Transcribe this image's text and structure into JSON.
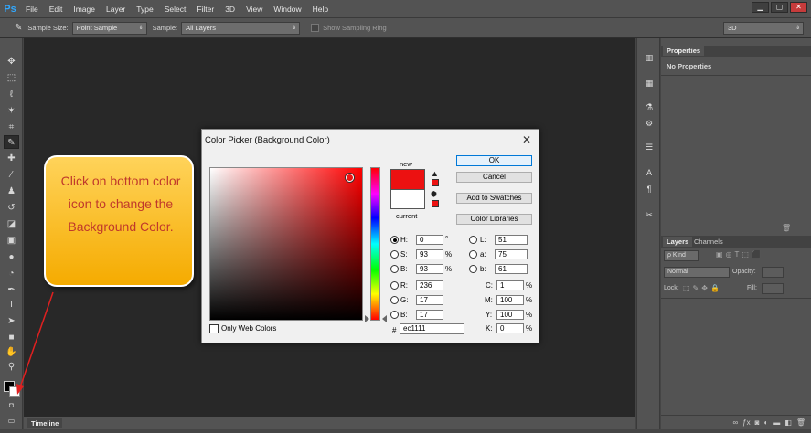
{
  "app": {
    "logo": "Ps"
  },
  "menu": [
    "File",
    "Edit",
    "Image",
    "Layer",
    "Type",
    "Select",
    "Filter",
    "3D",
    "View",
    "Window",
    "Help"
  ],
  "window_controls": [
    "▁",
    "▢",
    "✕"
  ],
  "options": {
    "sample_size_label": "Sample Size:",
    "sample_size_value": "Point Sample",
    "sample_label": "Sample:",
    "sample_value": "All Layers",
    "show_ring_label": "Show Sampling Ring",
    "workspace_value": "3D"
  },
  "panels": {
    "properties_tab": "Properties",
    "no_properties": "No Properties",
    "layers_tab": "Layers",
    "channels_tab": "Channels",
    "kind_label": "ρ Kind",
    "blend_mode": "Normal",
    "opacity_label": "Opacity:",
    "lock_label": "Lock:",
    "fill_label": "Fill:"
  },
  "timeline_label": "Timeline",
  "dialog": {
    "title": "Color Picker (Background Color)",
    "close": "✕",
    "new_label": "new",
    "current_label": "current",
    "new_color": "#ec1111",
    "current_color": "#ffffff",
    "ok": "OK",
    "cancel": "Cancel",
    "add_swatches": "Add to Swatches",
    "color_libraries": "Color Libraries",
    "only_web_colors": "Only Web Colors",
    "fields": {
      "H": {
        "label": "H:",
        "value": "0",
        "unit": "°"
      },
      "S": {
        "label": "S:",
        "value": "93",
        "unit": "%"
      },
      "B": {
        "label": "B:",
        "value": "93",
        "unit": "%"
      },
      "R": {
        "label": "R:",
        "value": "236"
      },
      "G": {
        "label": "G:",
        "value": "17"
      },
      "Bl": {
        "label": "B:",
        "value": "17"
      },
      "L": {
        "label": "L:",
        "value": "51"
      },
      "a": {
        "label": "a:",
        "value": "75"
      },
      "b": {
        "label": "b:",
        "value": "61"
      },
      "C": {
        "label": "C:",
        "value": "1",
        "unit": "%"
      },
      "M": {
        "label": "M:",
        "value": "100",
        "unit": "%"
      },
      "Y": {
        "label": "Y:",
        "value": "100",
        "unit": "%"
      },
      "K": {
        "label": "K:",
        "value": "0",
        "unit": "%"
      }
    },
    "hex_label": "#",
    "hex_value": "ec1111"
  },
  "callout": {
    "text": "Click on bottom color icon to change the Background Color."
  },
  "colors": {
    "accent_ps": "#31a8ff",
    "callout_fill": "#f5ab00",
    "callout_text": "#c0392b",
    "arrow": "#e02020"
  }
}
